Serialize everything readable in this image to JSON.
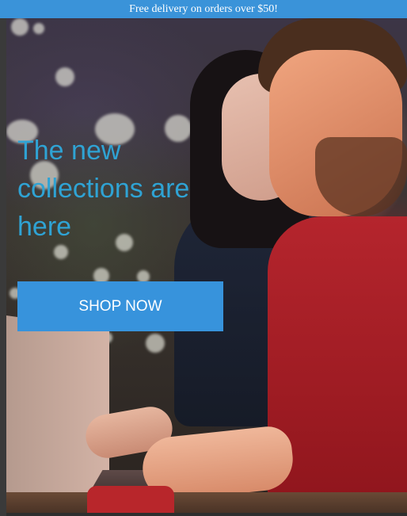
{
  "promo": {
    "text": "Free delivery on orders over $50!"
  },
  "hero": {
    "headline": "The new collections are here",
    "cta_label": "SHOP NOW",
    "image_subject": "couple-at-laptop-photo"
  },
  "colors": {
    "promo_bar": "#3a93d9",
    "headline": "#2fa3d4",
    "cta_background": "#3793dc",
    "cta_text": "#ffffff"
  }
}
